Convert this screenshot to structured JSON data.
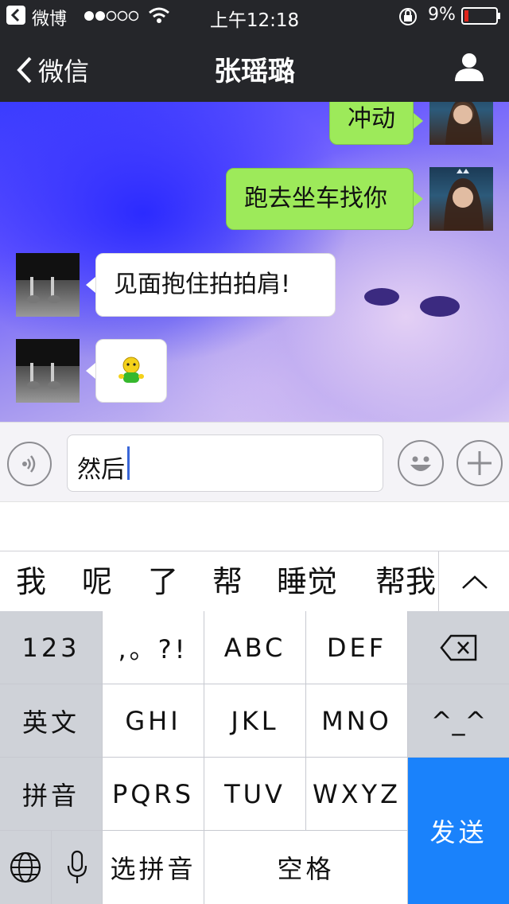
{
  "status_bar": {
    "back_app": "微博",
    "time": "上午12:18",
    "battery": "9%"
  },
  "nav": {
    "back_label": "微信",
    "title": "张瑶璐"
  },
  "messages": [
    {
      "side": "right",
      "text": "冲动"
    },
    {
      "side": "right",
      "text": "跑去坐车找你"
    },
    {
      "side": "left",
      "text": "见面抱住拍拍肩!"
    },
    {
      "side": "left",
      "emoji": "green-figure-emoji"
    }
  ],
  "input": {
    "value": "然后"
  },
  "candidates": [
    "我",
    "呢",
    "了",
    "帮",
    "睡觉",
    "帮我"
  ],
  "keyboard": {
    "row1": {
      "left": "123",
      "keys": [
        ",。?!",
        "ABC",
        "DEF"
      ],
      "right_icon": "backspace-icon"
    },
    "row2": {
      "left": "英文",
      "keys": [
        "GHI",
        "JKL",
        "MNO"
      ],
      "right": "^_^"
    },
    "row3": {
      "left": "拼音",
      "keys": [
        "PQRS",
        "TUV",
        "WXYZ"
      ]
    },
    "row4": {
      "select_pinyin": "选拼音",
      "space": "空格"
    },
    "send": "发送"
  },
  "colors": {
    "accent_send": "#1a82fb",
    "bubble_green": "#9dea5a",
    "cursor": "#3a67d8",
    "battery_low": "#e0251b"
  }
}
